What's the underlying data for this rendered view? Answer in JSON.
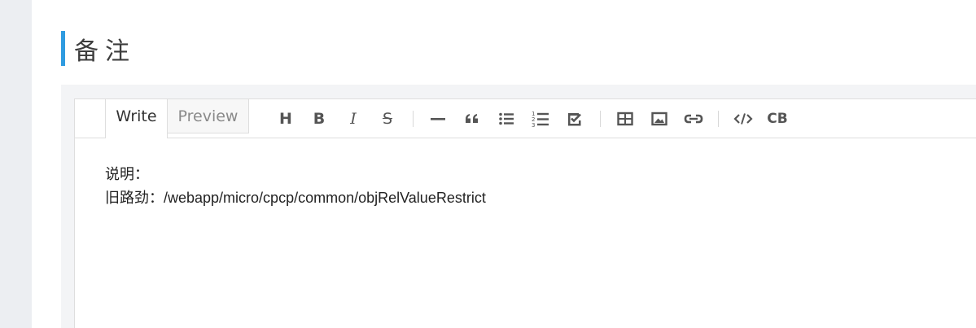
{
  "section": {
    "title": "备注",
    "accent_color": "#2f9be0"
  },
  "editor": {
    "tabs": {
      "write": "Write",
      "preview": "Preview"
    },
    "toolbar": {
      "heading": "H",
      "bold": "B",
      "italic": "I",
      "strikethrough": "S",
      "code_block": "CB",
      "icons": [
        "horizontal-rule-icon",
        "quote-icon",
        "unordered-list-icon",
        "ordered-list-icon",
        "checklist-icon",
        "table-icon",
        "image-icon",
        "link-icon",
        "inline-code-icon"
      ]
    },
    "content": {
      "line1": "说明：",
      "line2": "旧路劲：/webapp/micro/cpcp/common/objRelValueRestrict"
    }
  }
}
